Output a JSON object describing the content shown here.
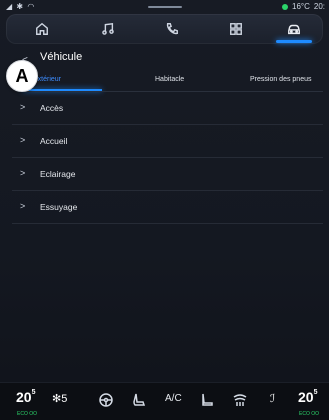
{
  "status_bar": {
    "left_icons": "signal bluetooth wifi",
    "temperature": "16°C",
    "time": "20:"
  },
  "nav": {
    "items": [
      {
        "icon": "home-icon"
      },
      {
        "icon": "music-icon"
      },
      {
        "icon": "phone-icon"
      },
      {
        "icon": "apps-icon"
      },
      {
        "icon": "car-icon",
        "active": true
      }
    ]
  },
  "header": {
    "back_symbol": "<",
    "title": "Véhicule"
  },
  "callout": "A",
  "tabs": [
    {
      "label": "Extérieur",
      "selected": true
    },
    {
      "label": "Habitacle"
    },
    {
      "label": "Pression des pneus"
    }
  ],
  "list": [
    {
      "label": "Accès"
    },
    {
      "label": "Accueil"
    },
    {
      "label": "Eclairage"
    },
    {
      "label": "Essuyage"
    }
  ],
  "bottom_bar": {
    "left_temp": "20",
    "left_temp_decimal": "5",
    "left_eco": "ECO OO",
    "fan_speed": "5",
    "ac_label": "A/C",
    "right_temp": "20",
    "right_temp_decimal": "5",
    "right_eco": "ECO OO"
  },
  "colors": {
    "accent": "#1e8bff",
    "status_dot": "#2bd46a",
    "background": "#141821"
  }
}
